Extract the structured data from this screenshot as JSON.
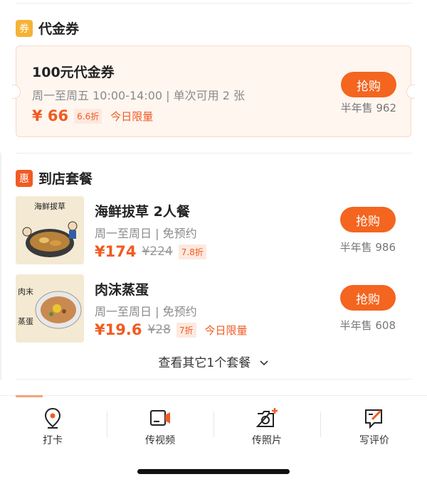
{
  "voucher_section": {
    "icon_char": "券",
    "title": "代金券",
    "icon_color": "#f5b335"
  },
  "voucher": {
    "title": "100元代金券",
    "desc": "周一至周五 10:00-14:00 | 单次可用 2 张",
    "price": "¥ 66",
    "discount": "6.6折",
    "limit": "今日限量",
    "buy_label": "抢购",
    "sold": "半年售 962"
  },
  "package_section": {
    "icon_char": "惠",
    "title": "到店套餐",
    "icon_color": "#f15a22"
  },
  "packages": [
    {
      "name": "海鲜拔草 2人餐",
      "desc": "周一至周日 | 免预约",
      "price": "¥174",
      "original": "¥224",
      "discount": "7.8折",
      "limit": "",
      "buy_label": "抢购",
      "sold": "半年售 986",
      "thumb_text": "海鲜拔草"
    },
    {
      "name": "肉沫蒸蛋",
      "desc": "周一至周日 | 免预约",
      "price": "¥19.6",
      "original": "¥28",
      "discount": "7折",
      "limit": "今日限量",
      "buy_label": "抢购",
      "sold": "半年售 608",
      "thumb_text_top": "肉末",
      "thumb_text_bottom": "蒸蛋"
    }
  ],
  "more_link": "查看其它1个套餐",
  "bottom_actions": [
    {
      "label": "打卡",
      "icon": "location-pin-icon"
    },
    {
      "label": "传视频",
      "icon": "video-icon"
    },
    {
      "label": "传照片",
      "icon": "camera-add-icon"
    },
    {
      "label": "写评价",
      "icon": "write-review-icon"
    }
  ],
  "colors": {
    "accent": "#f15a22",
    "button": "#f4651f",
    "voucher_bg": "#fff6f0"
  }
}
